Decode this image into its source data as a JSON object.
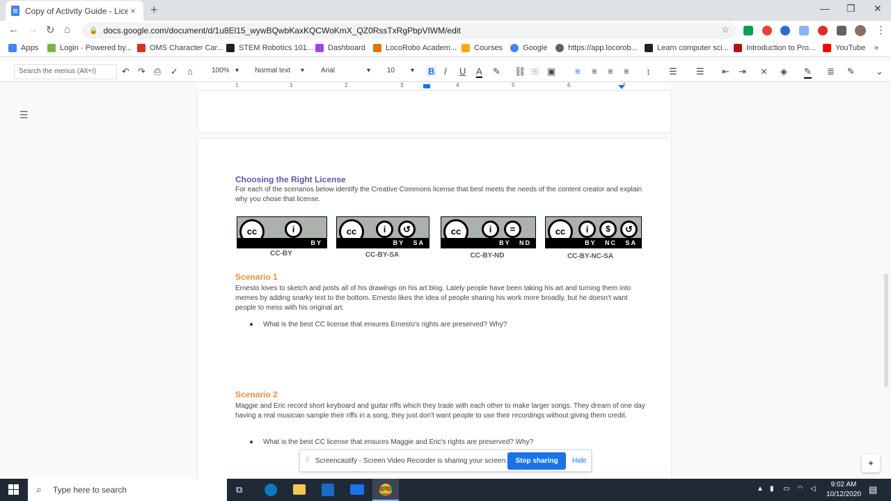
{
  "browser": {
    "tab_title": "Copy of Activity Guide - Licensin",
    "tab_close": "×",
    "new_tab": "+",
    "url": "docs.google.com/document/d/1u8El15_wywBQwbKaxKQCWoKmX_QZ0RssTxRgPbpVIWM/edit",
    "window_controls": [
      "—",
      "❐",
      "✕"
    ]
  },
  "bookmarks": [
    {
      "label": "Apps",
      "color": "#4285f4"
    },
    {
      "label": "Login - Powered by...",
      "color": "#7cb342"
    },
    {
      "label": "OMS Character Car...",
      "color": "#d93025"
    },
    {
      "label": "STEM Robotics 101...",
      "color": "#202124"
    },
    {
      "label": "Dashboard",
      "color": "#a142f4"
    },
    {
      "label": "LocoRobo Academ...",
      "color": "#e37400"
    },
    {
      "label": "Courses",
      "color": "#f9ab00"
    },
    {
      "label": "Google",
      "color": "#4285f4"
    },
    {
      "label": "https://app.locorob...",
      "color": "#5f6368"
    },
    {
      "label": "Learn computer sci...",
      "color": "#202124"
    },
    {
      "label": "Introduction to Pro...",
      "color": "#b31412"
    },
    {
      "label": "YouTube",
      "color": "#ff0000"
    }
  ],
  "toolbar": {
    "search_placeholder": "Search the menus (Alt+/)",
    "zoom": "100%",
    "style": "Normal text",
    "font": "Arial",
    "font_size": "10"
  },
  "ruler": [
    "1",
    "1",
    "2",
    "3",
    "4",
    "5",
    "6",
    "7"
  ],
  "document": {
    "section_title": "Choosing the Right License",
    "intro": "For each of the scenarios below identify the Creative Commons license that best meets the needs of the content creator and explain why you chose that license.",
    "licenses": [
      {
        "label": "CC-BY",
        "badge": "BY"
      },
      {
        "label": "CC-BY-SA",
        "badge": "BY SA"
      },
      {
        "label": "CC-BY-ND",
        "badge": "BY ND"
      },
      {
        "label": "CC-BY-NC-SA",
        "badge": "BY NC SA"
      }
    ],
    "scenario1": {
      "title": "Scenario 1",
      "text": "Ernesto loves to sketch and posts all of his drawings on his art blog. Lately people have been taking his art and turning them into memes by adding snarky text to the bottom. Ernesto likes the idea of people sharing his work more broadly, but he doesn't want people to mess with his original art.",
      "question": "What is the best CC license that ensures Ernesto's rights are preserved? Why?"
    },
    "scenario2": {
      "title": "Scenario 2",
      "text": "Maggie and Eric record short keyboard and guitar riffs which they trade with each other to make larger songs. They dream of one day having a real musician sample their riffs in a song, they just don't want people to use their recordings without giving them credit.",
      "question": "What is the best CC license that ensures Maggie and Eric's rights are preserved? Why?"
    },
    "heading_color": "#e69138",
    "title_color": "#674ea7"
  },
  "screencastify": {
    "message": "Screencastify - Screen Video Recorder is sharing your screen.",
    "stop": "Stop sharing",
    "hide": "Hide"
  },
  "taskbar": {
    "search_placeholder": "Type here to search",
    "time": "9:02 AM",
    "date": "10/12/2020"
  }
}
